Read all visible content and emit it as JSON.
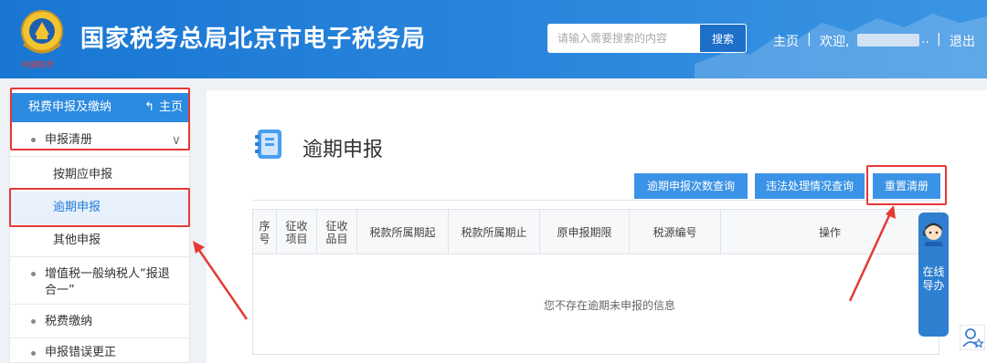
{
  "header": {
    "title": "国家税务总局北京市电子税务局",
    "seal_text": "中国税务",
    "search_placeholder": "请输入需要搜索的内容",
    "search_button": "搜索",
    "home_link": "主页",
    "separator": "|",
    "welcome": "欢迎,",
    "user_suffix": "..",
    "logout": "退出"
  },
  "sidebar": {
    "section_title": "税费申报及缴纳",
    "home_label": "主页",
    "items": [
      {
        "label": "申报清册"
      },
      {
        "label": "增值税一般纳税人“报退合一”"
      },
      {
        "label": "税费缴纳"
      },
      {
        "label": "申报错误更正"
      }
    ],
    "sub_items": [
      {
        "label": "按期应申报"
      },
      {
        "label": "逾期申报"
      },
      {
        "label": "其他申报"
      }
    ]
  },
  "main": {
    "title": "逾期申报",
    "buttons": {
      "count_query": "逾期申报次数查询",
      "violation_query": "违法处理情况查询",
      "reset": "重置清册"
    },
    "table": {
      "headers": [
        "序号",
        "征收项目",
        "征收品目",
        "税款所属期起",
        "税款所属期止",
        "原申报期限",
        "税源编号",
        "操作"
      ],
      "empty_message": "您不存在逾期未申报的信息"
    }
  },
  "float_guide": {
    "label": "在线导办"
  },
  "colors": {
    "header_blue": "#1976d2",
    "accent_blue": "#2a8be0",
    "button_blue": "#3a93e6",
    "annotation_red": "#e53935"
  }
}
